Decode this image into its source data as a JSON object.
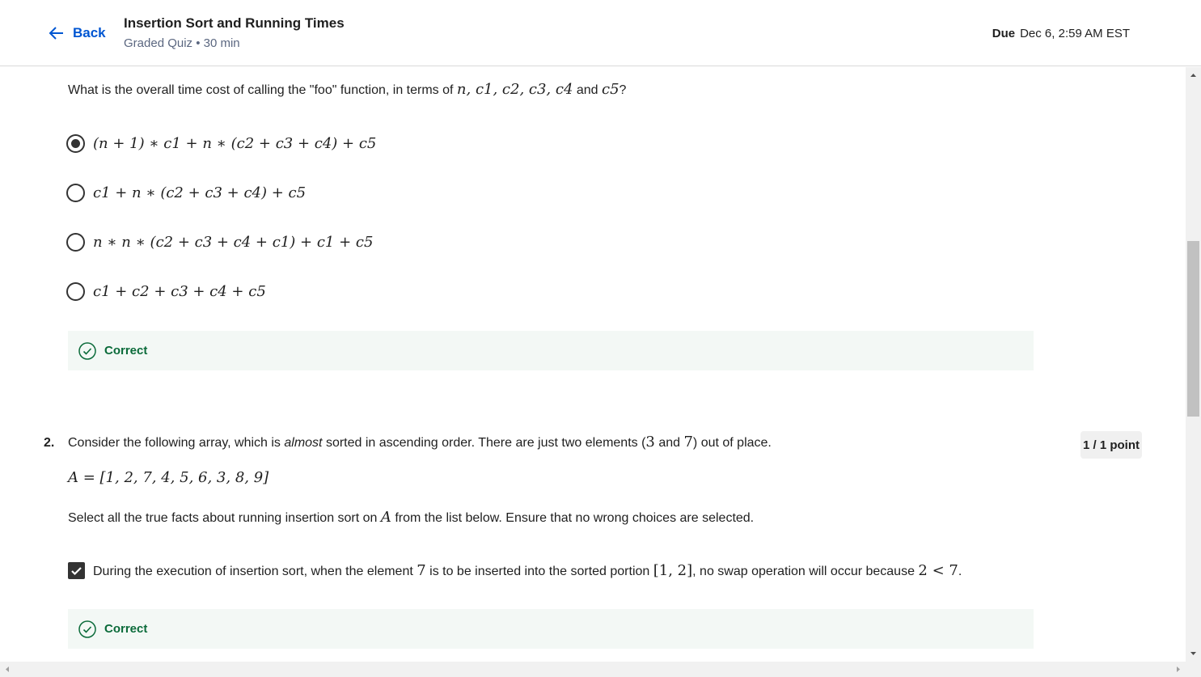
{
  "header": {
    "back_label": "Back",
    "title": "Insertion Sort and Running Times",
    "subtitle": "Graded Quiz • 30 min",
    "due_label": "Due",
    "due_value": "Dec 6, 2:59 AM EST"
  },
  "q1": {
    "prompt_prefix": "What is the overall time cost of calling the \"foo\" function, in terms of ",
    "prompt_vars": "n, c1, c2, c3, c4",
    "prompt_and": " and ",
    "prompt_last": "c5",
    "prompt_suffix": "?",
    "options": [
      {
        "text": "(n + 1) ∗ c1 + n ∗ (c2 + c3 + c4) + c5",
        "selected": true
      },
      {
        "text": "c1 + n ∗ (c2 + c3 + c4) + c5",
        "selected": false
      },
      {
        "text": "n ∗ n ∗ (c2 + c3 + c4 + c1) + c1 + c5",
        "selected": false
      },
      {
        "text": "c1 + c2 + c3 + c4 + c5",
        "selected": false
      }
    ],
    "feedback": "Correct"
  },
  "q2": {
    "number": "2.",
    "points": "1 / 1 point",
    "prompt_a": "Consider the following array, which is ",
    "prompt_em": "almost",
    "prompt_b": " sorted in ascending order.  There are just two elements (",
    "prompt_n1": "3",
    "prompt_c": " and ",
    "prompt_n2": "7",
    "prompt_d": ") out of place.",
    "array": "A = [1, 2, 7, 4, 5, 6, 3, 8, 9]",
    "instruction_a": "Select all the true facts about running insertion sort on ",
    "instruction_var": "A",
    "instruction_b": " from the list below. Ensure that no wrong choices are selected.",
    "choice1": {
      "part1": "During the execution of insertion sort, when the element ",
      "m1": "7",
      "part2": " is to be inserted into the sorted portion ",
      "m2": "[1, 2]",
      "part3": ", no swap operation will occur because ",
      "m3": "2 < 7",
      "part4": ".",
      "checked": true
    },
    "feedback": "Correct"
  },
  "colors": {
    "link": "#0056d2",
    "correct": "#0b6b3a",
    "feedback_bg": "#f3f8f5"
  }
}
